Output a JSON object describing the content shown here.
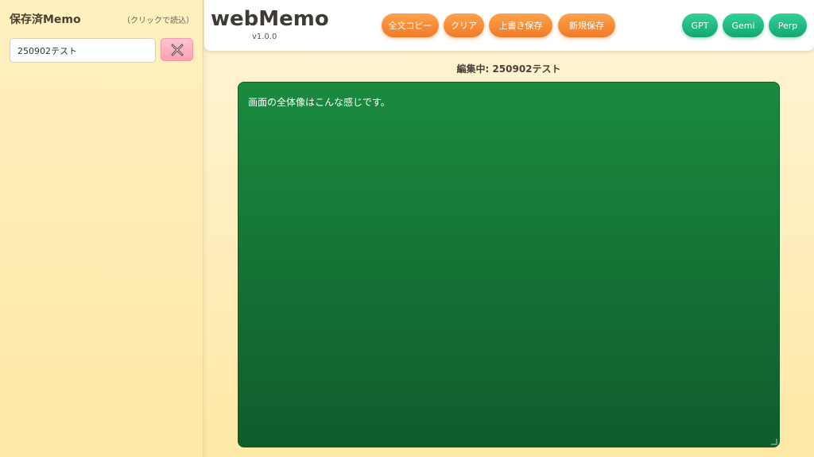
{
  "sidebar": {
    "title": "保存済Memo",
    "hint": "（クリックで読込）",
    "memos": [
      {
        "name": "250902テスト"
      }
    ],
    "delete_icon": "close-x-icon"
  },
  "header": {
    "title": "webMemo",
    "version": "v1.0.0",
    "buttons": {
      "copy_all": "全文コピー",
      "clear": "クリア",
      "overwrite": "上書き保存",
      "new_save": "新規保存",
      "gpt": "GPT",
      "gemi": "Gemi",
      "perp": "Perp"
    }
  },
  "editor": {
    "label": "編集中: 250902テスト",
    "content": "画面の全体像はこんな感じです。"
  },
  "colors": {
    "accent_orange": "#f48a33",
    "accent_green": "#1fb981",
    "editor_green": "#1a7f3c",
    "delete_pink": "#ffb3bf"
  }
}
